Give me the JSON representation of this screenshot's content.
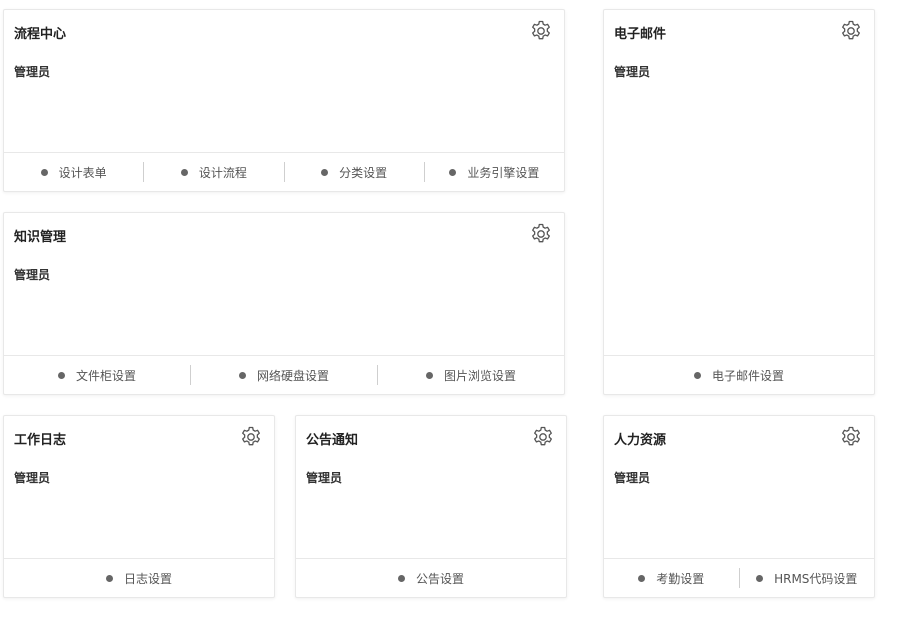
{
  "colors": {
    "dot": "#666666",
    "border": "#e8e8e8",
    "title": "#222222",
    "gear": "#555555"
  },
  "cards": {
    "workflow": {
      "title": "流程中心",
      "role": "管理员",
      "icon": "gear-icon",
      "links": [
        "设计表单",
        "设计流程",
        "分类设置",
        "业务引擎设置"
      ]
    },
    "email": {
      "title": "电子邮件",
      "role": "管理员",
      "icon": "gear-icon",
      "links": [
        "电子邮件设置"
      ]
    },
    "knowledge": {
      "title": "知识管理",
      "role": "管理员",
      "icon": "gear-icon",
      "links": [
        "文件柜设置",
        "网络硬盘设置",
        "图片浏览设置"
      ]
    },
    "worklog": {
      "title": "工作日志",
      "role": "管理员",
      "icon": "gear-icon",
      "links": [
        "日志设置"
      ]
    },
    "notice": {
      "title": "公告通知",
      "role": "管理员",
      "icon": "gear-icon",
      "links": [
        "公告设置"
      ]
    },
    "hr": {
      "title": "人力资源",
      "role": "管理员",
      "icon": "gear-icon",
      "links": [
        "考勤设置",
        "HRMS代码设置"
      ]
    }
  }
}
